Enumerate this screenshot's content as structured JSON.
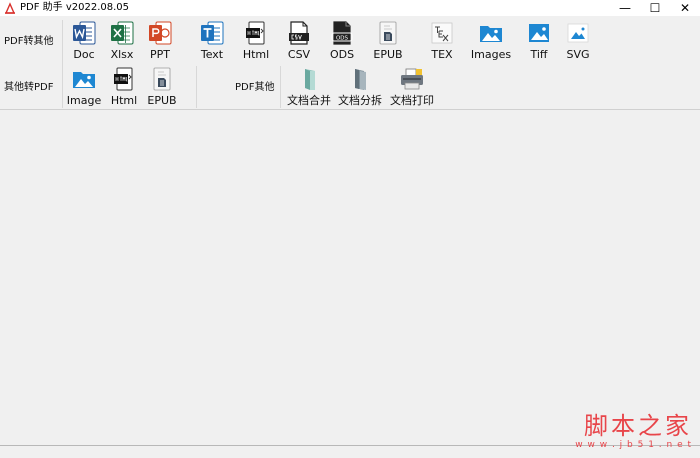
{
  "window": {
    "title": "PDF 助手 v2022.08.05",
    "minimize_glyph": "—",
    "maximize_glyph": "☐",
    "close_glyph": "✕"
  },
  "toolbar": {
    "pdf_to_other_label": "PDF转其他",
    "other_to_pdf_label": "其他转PDF",
    "pdf_other_label": "PDF其他",
    "pdf_to_other": [
      {
        "label": "Doc",
        "icon": "word-icon"
      },
      {
        "label": "Xlsx",
        "icon": "excel-icon"
      },
      {
        "label": "PPT",
        "icon": "powerpoint-icon"
      },
      {
        "label": "Text",
        "icon": "text-icon"
      },
      {
        "label": "Html",
        "icon": "html-icon"
      },
      {
        "label": "CSV",
        "icon": "csv-icon"
      },
      {
        "label": "ODS",
        "icon": "ods-icon"
      },
      {
        "label": "EPUB",
        "icon": "epub-icon"
      },
      {
        "label": "TEX",
        "icon": "tex-icon"
      },
      {
        "label": "Images",
        "icon": "images-icon"
      },
      {
        "label": "Tiff",
        "icon": "tiff-icon"
      },
      {
        "label": "SVG",
        "icon": "svg-icon"
      }
    ],
    "other_to_pdf": [
      {
        "label": "Image",
        "icon": "image-icon"
      },
      {
        "label": "Html",
        "icon": "html-icon"
      },
      {
        "label": "EPUB",
        "icon": "epub-icon"
      }
    ],
    "pdf_other": [
      {
        "label": "文档合并",
        "icon": "merge-icon"
      },
      {
        "label": "文档分拆",
        "icon": "split-icon"
      },
      {
        "label": "文档打印",
        "icon": "printer-icon"
      }
    ]
  },
  "watermark": {
    "main": "脚本之家",
    "sub": "w w w . j b 5 1 . n e t"
  },
  "colors": {
    "word": "#2b5797",
    "excel": "#1e7145",
    "powerpoint": "#d24726",
    "text": "#1e73be",
    "images": "#1e87d2",
    "watermark": "#e8454a"
  }
}
